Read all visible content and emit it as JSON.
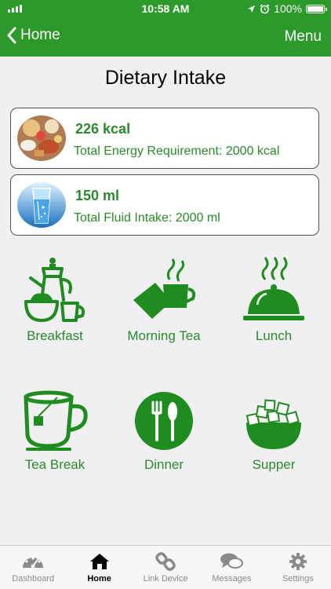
{
  "status": {
    "time": "10:58 AM",
    "battery": "100%",
    "battery_level": 1.0
  },
  "nav": {
    "back_label": "Home",
    "menu_label": "Menu"
  },
  "page": {
    "title": "Dietary Intake"
  },
  "energy": {
    "value": "226 kcal",
    "requirement": "Total Energy Requirement:  2000 kcal",
    "image": "food-platter-image"
  },
  "fluid": {
    "value": "150 ml",
    "requirement": "Total Fluid Intake: 2000 ml",
    "image": "water-glass-image"
  },
  "meals": [
    {
      "label": "Breakfast",
      "icon": "teapot-bowl-icon"
    },
    {
      "label": "Morning Tea",
      "icon": "tea-cup-icon"
    },
    {
      "label": "Lunch",
      "icon": "cloche-icon"
    },
    {
      "label": "Tea Break",
      "icon": "tea-mug-icon"
    },
    {
      "label": "Dinner",
      "icon": "fork-spoon-icon"
    },
    {
      "label": "Supper",
      "icon": "bowl-icon"
    }
  ],
  "tabs": [
    {
      "label": "Dashboard",
      "icon": "gauge-icon",
      "active": false
    },
    {
      "label": "Home",
      "icon": "home-icon",
      "active": true
    },
    {
      "label": "Link Device",
      "icon": "link-icon",
      "active": false
    },
    {
      "label": "Messages",
      "icon": "chat-icon",
      "active": false
    },
    {
      "label": "Settings",
      "icon": "gear-icon",
      "active": false
    }
  ],
  "colors": {
    "brand_green": "#2b9a2b",
    "text_green": "#2b8a2b",
    "icon_green": "#1f8c1f",
    "tab_inactive": "#8a8a8a"
  }
}
